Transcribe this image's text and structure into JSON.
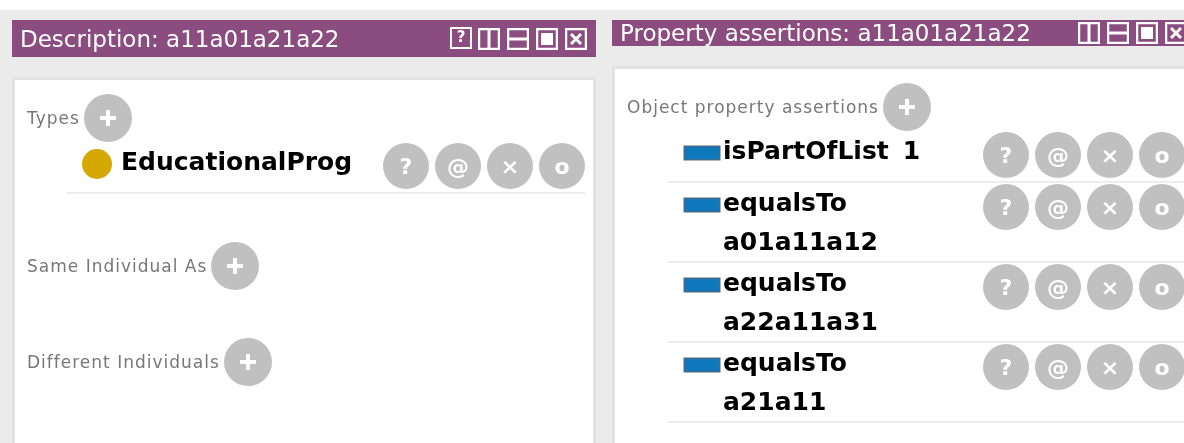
{
  "panels": [
    {
      "title": "Description: a11a01a21a22",
      "controls": [
        {
          "kind": "help",
          "label": "?"
        },
        {
          "kind": "split_vertical"
        },
        {
          "kind": "split_horizontal"
        },
        {
          "kind": "maximize"
        },
        {
          "kind": "close"
        }
      ],
      "sections": [
        {
          "label": "Types",
          "items": [
            {
              "kind": "class",
              "text": "EducationalProg",
              "buttons": [
                "?",
                "@",
                "×",
                "o"
              ]
            }
          ]
        },
        {
          "label": "Same Individual As"
        },
        {
          "label": "Different Individuals"
        }
      ]
    },
    {
      "title": "Property assertions: a11a01a21a22",
      "controls": [
        {
          "kind": "split_vertical"
        },
        {
          "kind": "split_horizontal"
        },
        {
          "kind": "maximize"
        },
        {
          "kind": "close"
        }
      ],
      "sections": [
        {
          "label": "Object property assertions",
          "items": [
            {
              "kind": "object_property",
              "text": "isPartOfList",
              "value": "1",
              "buttons": [
                "?",
                "@",
                "×",
                "o"
              ]
            },
            {
              "kind": "object_property",
              "text": "equalsTo",
              "value": "a01a11a12",
              "buttons": [
                "?",
                "@",
                "×",
                "o"
              ]
            },
            {
              "kind": "object_property",
              "text": "equalsTo",
              "value": "a22a11a31",
              "buttons": [
                "?",
                "@",
                "×",
                "o"
              ]
            },
            {
              "kind": "object_property",
              "text": "equalsTo",
              "value": "a21a11",
              "buttons": [
                "?",
                "@",
                "×",
                "o"
              ]
            }
          ]
        }
      ]
    }
  ]
}
